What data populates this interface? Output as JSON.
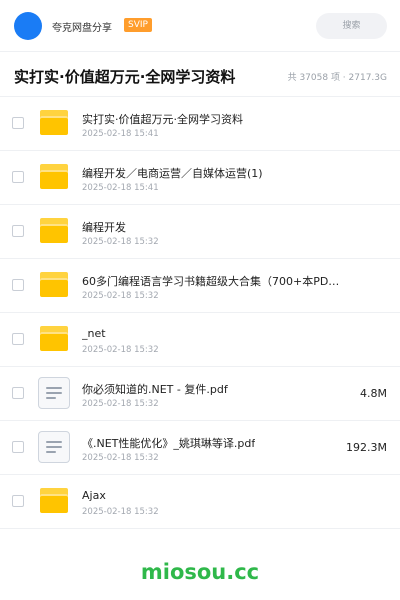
{
  "topbar": {
    "user_name": "夸克网盘分享",
    "badge": "SVIP",
    "search_placeholder": "搜索"
  },
  "header": {
    "title": "实打实·价值超万元·全网学习资料",
    "summary": "共 37058 项 · 2717.3G"
  },
  "files": [
    {
      "type": "folder",
      "icon": "folder-icon",
      "name": "实打实·价值超万元·全网学习资料",
      "date": "2025-02-18 15:41",
      "size": ""
    },
    {
      "type": "folder",
      "icon": "folder-icon",
      "name": "编程开发／电商运营／自媒体运营(1)",
      "date": "2025-02-18 15:41",
      "size": ""
    },
    {
      "type": "folder",
      "icon": "folder-icon",
      "name": "编程开发",
      "date": "2025-02-18 15:32",
      "size": ""
    },
    {
      "type": "folder",
      "icon": "folder-icon",
      "name": "60多门编程语言学习书籍超级大合集（700+本PD…",
      "date": "2025-02-18 15:32",
      "size": ""
    },
    {
      "type": "folder",
      "icon": "folder-icon",
      "name": "_net",
      "date": "2025-02-18 15:32",
      "size": ""
    },
    {
      "type": "file",
      "icon": "document-icon",
      "name": "你必须知道的.NET - 复件.pdf",
      "date": "2025-02-18 15:32",
      "size": "4.8M"
    },
    {
      "type": "file",
      "icon": "document-icon",
      "name": "《.NET性能优化》_姚琪琳等译.pdf",
      "date": "2025-02-18 15:32",
      "size": "192.3M"
    },
    {
      "type": "folder",
      "icon": "folder-icon",
      "name": "Ajax",
      "date": "2025-02-18 15:32",
      "size": ""
    }
  ],
  "watermark": "miosou.cc",
  "colors": {
    "avatar": "#1a7cf5",
    "badge": "#ff9d2c",
    "folder": "#ffc400",
    "watermark": "#2fb84a"
  }
}
